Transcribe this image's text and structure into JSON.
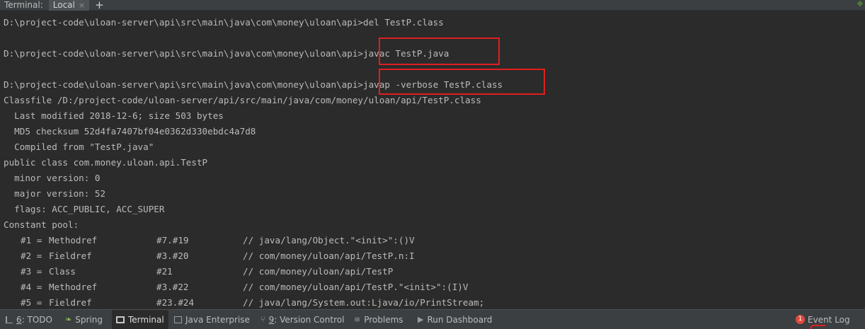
{
  "tabbar": {
    "title": "Terminal:",
    "tab_label": "Local",
    "close_glyph": "×",
    "add_glyph": "+"
  },
  "terminal": {
    "lines": [
      "D:\\project-code\\uloan-server\\api\\src\\main\\java\\com\\money\\uloan\\api>del TestP.class",
      "",
      "D:\\project-code\\uloan-server\\api\\src\\main\\java\\com\\money\\uloan\\api>javac TestP.java",
      "",
      "D:\\project-code\\uloan-server\\api\\src\\main\\java\\com\\money\\uloan\\api>javap -verbose TestP.class",
      "Classfile /D:/project-code/uloan-server/api/src/main/java/com/money/uloan/api/TestP.class",
      "  Last modified 2018-12-6; size 503 bytes",
      "  MD5 checksum 52d4fa7407bf04e0362d330ebdc4a7d8",
      "  Compiled from \"TestP.java\"",
      "public class com.money.uloan.api.TestP",
      "  minor version: 0",
      "  major version: 52",
      "  flags: ACC_PUBLIC, ACC_SUPER",
      "Constant pool:"
    ],
    "constant_pool": [
      {
        "num": "#1 =",
        "type": "Methodref",
        "ref": "#7.#19",
        "comment": "// java/lang/Object.\"<init>\":()V"
      },
      {
        "num": "#2 =",
        "type": "Fieldref",
        "ref": "#3.#20",
        "comment": "// com/money/uloan/api/TestP.n:I"
      },
      {
        "num": "#3 =",
        "type": "Class",
        "ref": "#21",
        "comment": "// com/money/uloan/api/TestP"
      },
      {
        "num": "#4 =",
        "type": "Methodref",
        "ref": "#3.#22",
        "comment": "// com/money/uloan/api/TestP.\"<init>\":(I)V"
      },
      {
        "num": "#5 =",
        "type": "Fieldref",
        "ref": "#23.#24",
        "comment": "// java/lang/System.out:Ljava/io/PrintStream;"
      }
    ],
    "highlight_color": "#e01e1e"
  },
  "bottombar": {
    "items": [
      {
        "id": "todo",
        "mnemonic": "6",
        "label": ": TODO",
        "icon": "todo-icon"
      },
      {
        "id": "spring",
        "mnemonic": "",
        "label": "Spring",
        "icon": "spring-icon"
      },
      {
        "id": "terminal",
        "mnemonic": "",
        "label": "Terminal",
        "icon": "terminal-icon"
      },
      {
        "id": "java-enterprise",
        "mnemonic": "",
        "label": "Java Enterprise",
        "icon": "java-enterprise-icon"
      },
      {
        "id": "version-control",
        "mnemonic": "9",
        "label": ": Version Control",
        "icon": "version-control-icon"
      },
      {
        "id": "problems",
        "mnemonic": "",
        "label": "Problems",
        "icon": "problems-icon"
      },
      {
        "id": "run-dashboard",
        "mnemonic": "",
        "label": "Run Dashboard",
        "icon": "run-dashboard-icon"
      }
    ],
    "event_log": {
      "badge": "1",
      "label": "Event Log"
    }
  }
}
